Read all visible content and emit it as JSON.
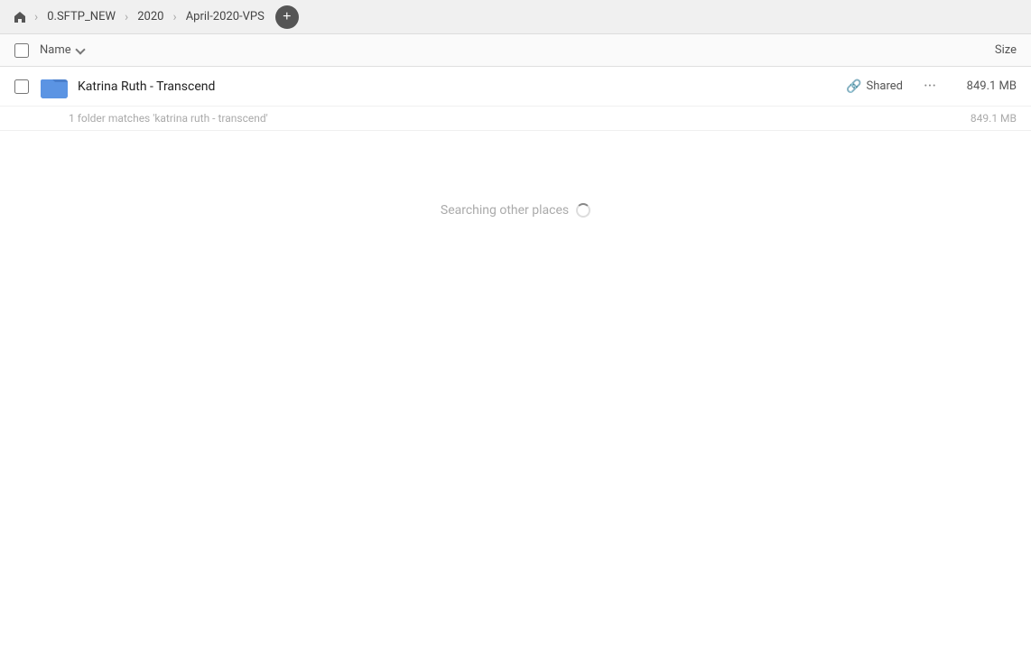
{
  "toolbar": {
    "home_icon": "home",
    "breadcrumbs": [
      {
        "label": "0.SFTP_NEW",
        "id": "bc-sftp"
      },
      {
        "label": "2020",
        "id": "bc-2020"
      },
      {
        "label": "April-2020-VPS",
        "id": "bc-april"
      }
    ],
    "add_button_label": "+"
  },
  "columns": {
    "name_label": "Name",
    "size_label": "Size"
  },
  "file_row": {
    "checkbox_visible": false,
    "folder_name": "Katrina Ruth - Transcend",
    "shared_label": "Shared",
    "more_label": "···",
    "size": "849.1 MB"
  },
  "match_info": {
    "text": "1 folder matches 'katrina ruth - transcend'",
    "size": "849.1 MB"
  },
  "searching": {
    "text": "Searching other places"
  }
}
